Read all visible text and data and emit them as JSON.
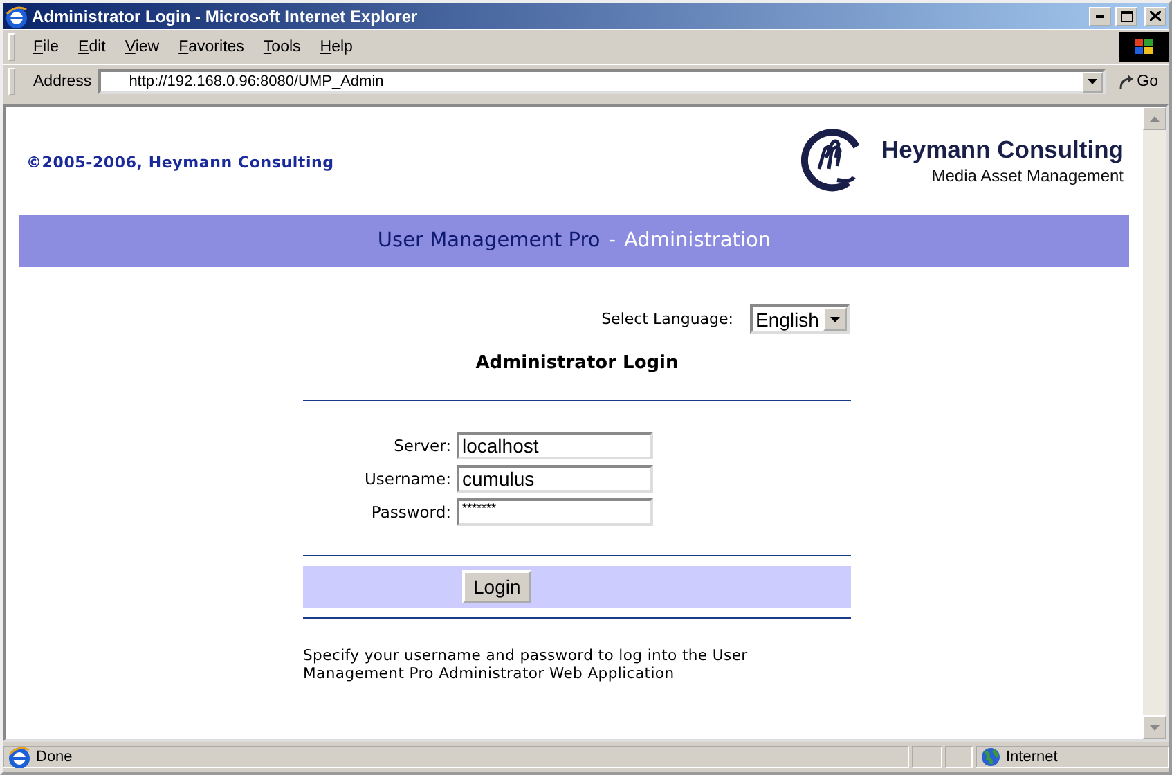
{
  "window": {
    "title": "Administrator Login - Microsoft Internet Explorer"
  },
  "menu": [
    "File",
    "Edit",
    "View",
    "Favorites",
    "Tools",
    "Help"
  ],
  "address_bar": {
    "label": "Address",
    "url": "http://192.168.0.96:8080/UMP_Admin",
    "go": "Go"
  },
  "page": {
    "copyright": "©2005-2006, Heymann Consulting",
    "logo": {
      "name": "Heymann Consulting",
      "tagline": "Media Asset Management"
    },
    "banner": {
      "product": "User Management Pro",
      "separator": "-",
      "section": "Administration"
    },
    "language": {
      "label": "Select Language:",
      "value": "English"
    },
    "heading": "Administrator Login",
    "fields": [
      {
        "label": "Server:",
        "value": "localhost"
      },
      {
        "label": "Username:",
        "value": "cumulus"
      },
      {
        "label": "Password:",
        "value": "*******"
      }
    ],
    "login_button": "Login",
    "help_text": "Specify your username and password to log into the User Management Pro Administrator Web Application"
  },
  "status_bar": {
    "text": "Done",
    "zone": "Internet"
  }
}
